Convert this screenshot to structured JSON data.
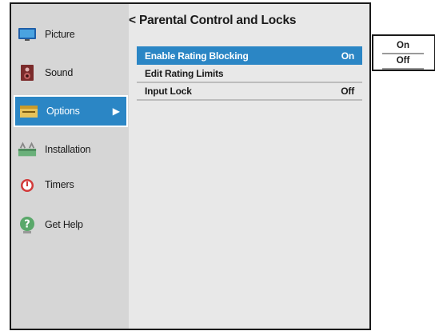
{
  "sidebar": {
    "items": [
      {
        "label": "Picture",
        "icon": "picture-icon"
      },
      {
        "label": "Sound",
        "icon": "speaker-icon"
      },
      {
        "label": "Options",
        "icon": "options-icon",
        "selected": true
      },
      {
        "label": "Installation",
        "icon": "installation-icon"
      },
      {
        "label": "Timers",
        "icon": "timer-icon"
      },
      {
        "label": "Get Help",
        "icon": "help-icon"
      }
    ],
    "selected_arrow": "▶"
  },
  "main": {
    "title": "< Parental Control and Locks",
    "rows": [
      {
        "label": "Enable Rating Blocking",
        "value": "On",
        "selected": true
      },
      {
        "label": "Edit Rating Limits",
        "value": ""
      },
      {
        "label": "Input Lock",
        "value": "Off"
      }
    ]
  },
  "submenu": {
    "options": [
      "On",
      "Off"
    ]
  },
  "colors": {
    "accent": "#2b86c5",
    "sidebar_bg": "#d6d6d6",
    "panel_bg": "#e8e8e8"
  }
}
